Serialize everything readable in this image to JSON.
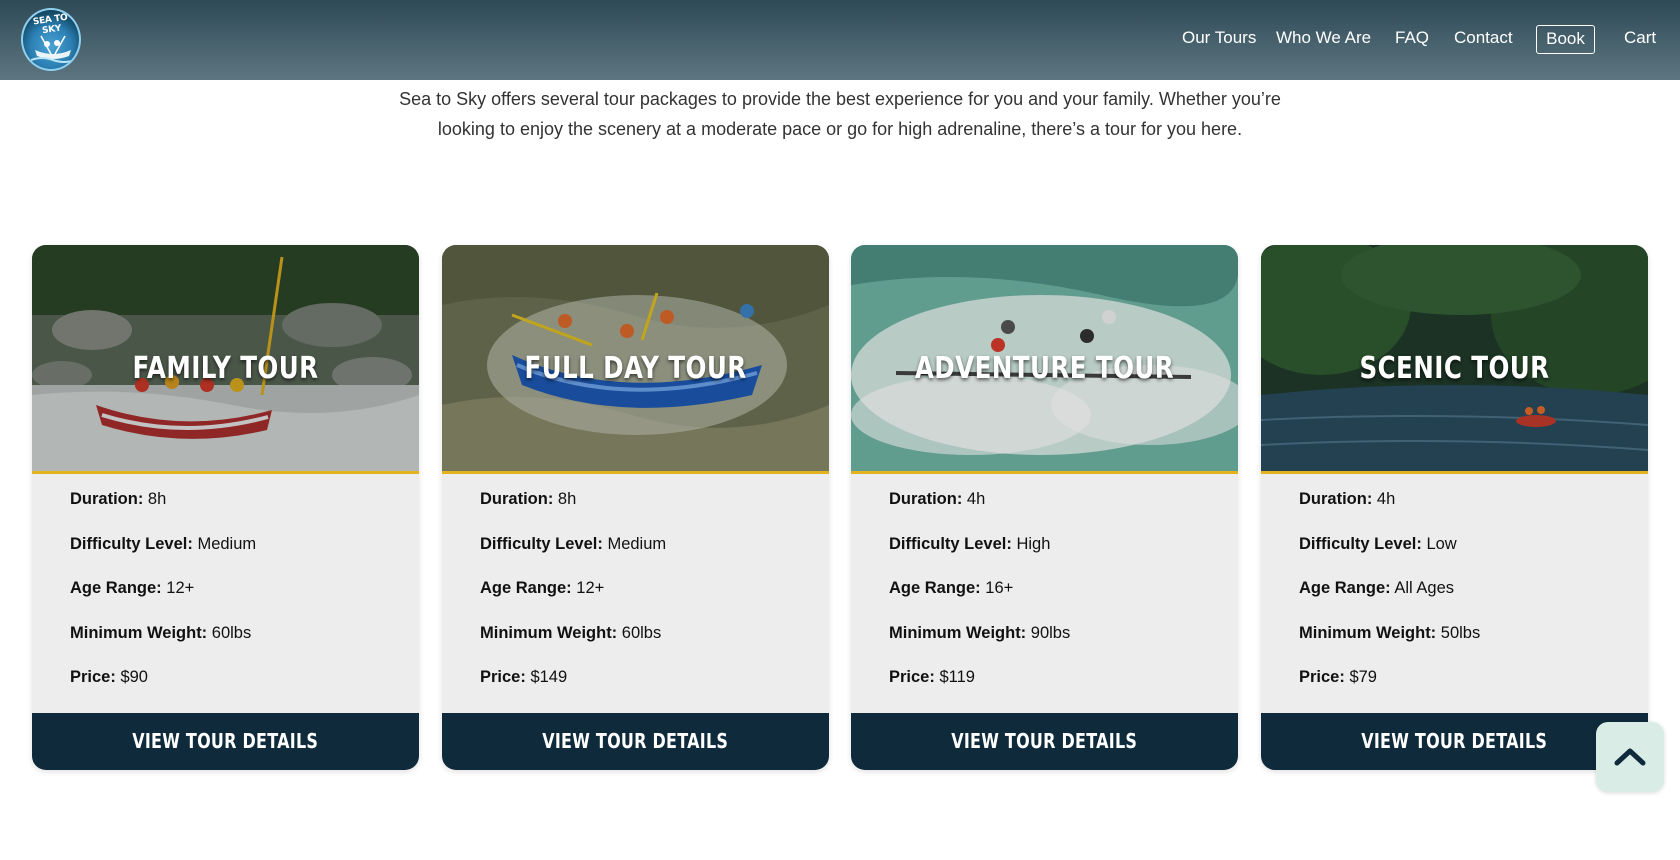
{
  "header": {
    "logo_text": "SEA TO SKY",
    "nav": [
      {
        "label": "Our Tours"
      },
      {
        "label": "Who We Are"
      },
      {
        "label": "FAQ"
      },
      {
        "label": "Contact"
      },
      {
        "label": "Book"
      },
      {
        "label": "Cart"
      }
    ]
  },
  "intro": {
    "line1": "Sea to Sky offers several tour packages to provide the best experience for you and your family. Whether you’re",
    "line2": "looking to enjoy the scenery at a moderate pace or go for high adrenaline, there’s a tour for you here."
  },
  "labels": {
    "duration": "Duration:",
    "difficulty": "Difficulty Level:",
    "age": "Age Range:",
    "weight": "Minimum Weight:",
    "price": "Price:"
  },
  "tours": [
    {
      "title": "FAMILY TOUR",
      "duration": "8h",
      "difficulty": "Medium",
      "age": "12+",
      "weight": "60lbs",
      "price": "$90",
      "button": "VIEW TOUR DETAILS"
    },
    {
      "title": "FULL DAY TOUR",
      "duration": "8h",
      "difficulty": "Medium",
      "age": "12+",
      "weight": "60lbs",
      "price": "$149",
      "button": "VIEW TOUR DETAILS"
    },
    {
      "title": "ADVENTURE TOUR",
      "duration": "4h",
      "difficulty": "High",
      "age": "16+",
      "weight": "90lbs",
      "price": "$119",
      "button": "VIEW TOUR DETAILS"
    },
    {
      "title": "SCENIC TOUR",
      "duration": "4h",
      "difficulty": "Low",
      "age": "All Ages",
      "weight": "50lbs",
      "price": "$79",
      "button": "VIEW TOUR DETAILS"
    }
  ],
  "colors": {
    "header_top": "#2e4a57",
    "accent_gold": "#e3b21f",
    "button_navy": "#0f2b3b",
    "card_bg": "#ededed",
    "to_top_bg": "#d9ece5"
  },
  "icons": {
    "back_to_top": "chevron-up-icon"
  }
}
